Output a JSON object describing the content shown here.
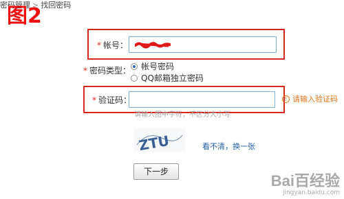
{
  "breadcrumb": {
    "parent": "密码管理",
    "separator": ">",
    "current": "找回密码"
  },
  "figure_tag": "图2",
  "account": {
    "label": "帐号：",
    "value_hidden": true
  },
  "password_type": {
    "label": "密码类型：",
    "options": [
      {
        "label": "帐号密码",
        "selected": true
      },
      {
        "label": "QQ邮箱独立密码",
        "selected": false
      }
    ]
  },
  "captcha": {
    "label": "验证码：",
    "value": "",
    "error_hint": "请输入验证码",
    "subhint": "请输入图中字符，不区分大小写",
    "image_text": "ZTU",
    "refresh_link": "看不清，换一张"
  },
  "next_button": "下一步",
  "watermark": {
    "brand": "Bai百经验",
    "url": "jingyan.baidu.com"
  },
  "colors": {
    "required_star": "#d9251d",
    "highlight_box": "#d9251d",
    "hint": "#e0761a",
    "link": "#1f5fa8",
    "input_border": "#7fb2d8"
  }
}
